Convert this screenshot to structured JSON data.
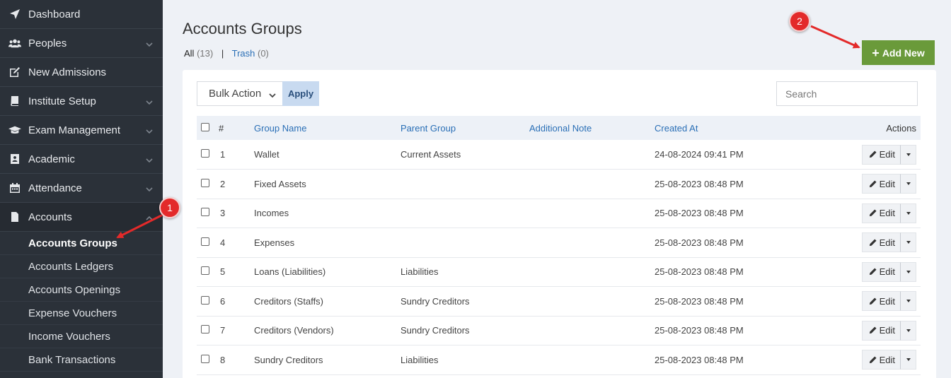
{
  "sidebar": {
    "items": [
      {
        "label": "Dashboard",
        "icon": "rocket-icon",
        "chevron": false
      },
      {
        "label": "Peoples",
        "icon": "users-icon",
        "chevron": true
      },
      {
        "label": "New Admissions",
        "icon": "edit-icon",
        "chevron": false
      },
      {
        "label": "Institute Setup",
        "icon": "book-icon",
        "chevron": true
      },
      {
        "label": "Exam Management",
        "icon": "graduation-cap-icon",
        "chevron": true
      },
      {
        "label": "Academic",
        "icon": "address-book-icon",
        "chevron": true
      },
      {
        "label": "Attendance",
        "icon": "calendar-icon",
        "chevron": true
      },
      {
        "label": "Accounts",
        "icon": "file-icon",
        "chevron": "up"
      }
    ],
    "accounts_sub": [
      {
        "label": "Accounts Groups",
        "active": true
      },
      {
        "label": "Accounts Ledgers"
      },
      {
        "label": "Accounts Openings"
      },
      {
        "label": "Expense Vouchers"
      },
      {
        "label": "Income Vouchers"
      },
      {
        "label": "Bank Transactions"
      }
    ]
  },
  "page": {
    "title": "Accounts Groups",
    "filter_all": "All",
    "filter_all_count": "(13)",
    "filter_sep": "|",
    "filter_trash": "Trash",
    "filter_trash_count": "(0)",
    "add_new_label": "Add New"
  },
  "toolbar": {
    "bulk_action": "Bulk Action",
    "apply_label": "Apply",
    "search_placeholder": "Search"
  },
  "table": {
    "headers": {
      "num": "#",
      "group_name": "Group Name",
      "parent_group": "Parent Group",
      "additional_note": "Additional Note",
      "created_at": "Created At",
      "actions": "Actions"
    },
    "edit_label": "Edit",
    "rows": [
      {
        "num": "1",
        "group_name": "Wallet",
        "parent_group": "Current Assets",
        "note": "",
        "created_at": "24-08-2024 09:41 PM"
      },
      {
        "num": "2",
        "group_name": "Fixed Assets",
        "parent_group": "",
        "note": "",
        "created_at": "25-08-2023 08:48 PM"
      },
      {
        "num": "3",
        "group_name": "Incomes",
        "parent_group": "",
        "note": "",
        "created_at": "25-08-2023 08:48 PM"
      },
      {
        "num": "4",
        "group_name": "Expenses",
        "parent_group": "",
        "note": "",
        "created_at": "25-08-2023 08:48 PM"
      },
      {
        "num": "5",
        "group_name": "Loans (Liabilities)",
        "parent_group": "Liabilities",
        "note": "",
        "created_at": "25-08-2023 08:48 PM"
      },
      {
        "num": "6",
        "group_name": "Creditors (Staffs)",
        "parent_group": "Sundry Creditors",
        "note": "",
        "created_at": "25-08-2023 08:48 PM"
      },
      {
        "num": "7",
        "group_name": "Creditors (Vendors)",
        "parent_group": "Sundry Creditors",
        "note": "",
        "created_at": "25-08-2023 08:48 PM"
      },
      {
        "num": "8",
        "group_name": "Sundry Creditors",
        "parent_group": "Liabilities",
        "note": "",
        "created_at": "25-08-2023 08:48 PM"
      }
    ]
  },
  "annotations": {
    "badge1": "1",
    "badge2": "2",
    "color": "#e32a2a"
  },
  "colors": {
    "sidebar_bg": "#2b3139",
    "add_button": "#6a9a3a",
    "link_blue": "#2a6fb6"
  }
}
